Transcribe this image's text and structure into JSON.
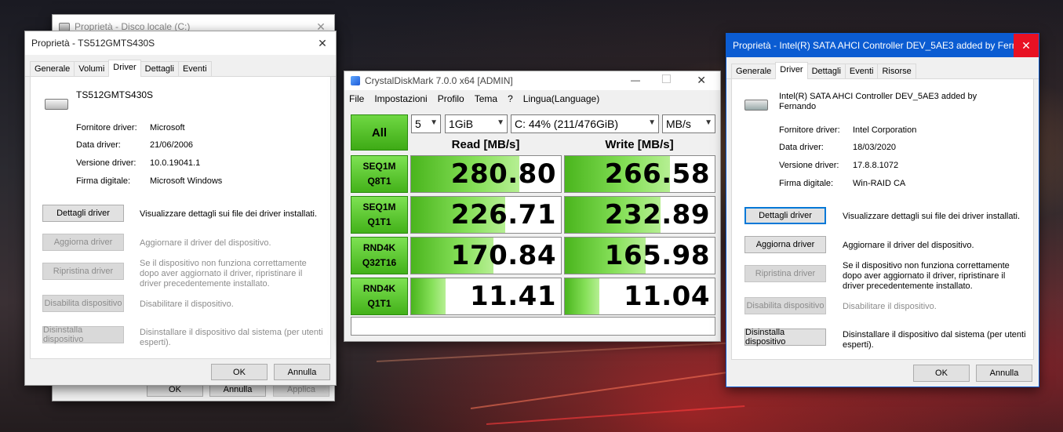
{
  "back_window": {
    "title": "Proprietà - Disco locale (C:)",
    "buttons": {
      "ok": "OK",
      "cancel": "Annulla",
      "apply": "Applica"
    }
  },
  "left_window": {
    "title": "Proprietà - TS512GMTS430S",
    "tabs": [
      "Generale",
      "Volumi",
      "Driver",
      "Dettagli",
      "Eventi"
    ],
    "active_tab": "Driver",
    "device_name": "TS512GMTS430S",
    "fields": [
      {
        "label": "Fornitore driver:",
        "value": "Microsoft"
      },
      {
        "label": "Data driver:",
        "value": "21/06/2006"
      },
      {
        "label": "Versione driver:",
        "value": "10.0.19041.1"
      },
      {
        "label": "Firma digitale:",
        "value": "Microsoft Windows"
      }
    ],
    "actions": [
      {
        "button": "Dettagli driver",
        "desc": "Visualizzare dettagli sui file dei driver installati.",
        "enabled": true
      },
      {
        "button": "Aggiorna driver",
        "desc": "Aggiornare il driver del dispositivo.",
        "enabled": false
      },
      {
        "button": "Ripristina driver",
        "desc": "Se il dispositivo non funziona correttamente dopo aver aggiornato il driver, ripristinare il driver precedentemente installato.",
        "enabled": false
      },
      {
        "button": "Disabilita dispositivo",
        "desc": "Disabilitare il dispositivo.",
        "enabled": false
      },
      {
        "button": "Disinstalla dispositivo",
        "desc": "Disinstallare il dispositivo dal sistema (per utenti esperti).",
        "enabled": false
      }
    ],
    "ok": "OK",
    "cancel": "Annulla"
  },
  "cdm": {
    "title": "CrystalDiskMark 7.0.0 x64 [ADMIN]",
    "menu": [
      "File",
      "Impostazioni",
      "Profilo",
      "Tema",
      "?",
      "Lingua(Language)"
    ],
    "all_button": "All",
    "count": "5",
    "size": "1GiB",
    "drive": "C: 44% (211/476GiB)",
    "unit": "MB/s",
    "read_header": "Read [MB/s]",
    "write_header": "Write [MB/s]",
    "rows": [
      {
        "line1": "SEQ1M",
        "line2": "Q8T1",
        "read": "280.80",
        "write": "266.58",
        "read_fill": 0.72,
        "write_fill": 0.7
      },
      {
        "line1": "SEQ1M",
        "line2": "Q1T1",
        "read": "226.71",
        "write": "232.89",
        "read_fill": 0.63,
        "write_fill": 0.64
      },
      {
        "line1": "RND4K",
        "line2": "Q32T16",
        "read": "170.84",
        "write": "165.98",
        "read_fill": 0.55,
        "write_fill": 0.54
      },
      {
        "line1": "RND4K",
        "line2": "Q1T1",
        "read": "11.41",
        "write": "11.04",
        "read_fill": 0.23,
        "write_fill": 0.23
      }
    ]
  },
  "right_window": {
    "title": "Proprietà - Intel(R) SATA AHCI Controller DEV_5AE3 added by Fern...",
    "tabs": [
      "Generale",
      "Driver",
      "Dettagli",
      "Eventi",
      "Risorse"
    ],
    "active_tab": "Driver",
    "device_name": "Intel(R) SATA AHCI Controller DEV_5AE3 added by Fernando",
    "fields": [
      {
        "label": "Fornitore driver:",
        "value": "Intel Corporation"
      },
      {
        "label": "Data driver:",
        "value": "18/03/2020"
      },
      {
        "label": "Versione driver:",
        "value": "17.8.8.1072"
      },
      {
        "label": "Firma digitale:",
        "value": "Win-RAID CA"
      }
    ],
    "actions": [
      {
        "button": "Dettagli driver",
        "desc": "Visualizzare dettagli sui file dei driver installati.",
        "enabled": true
      },
      {
        "button": "Aggiorna driver",
        "desc": "Aggiornare il driver del dispositivo.",
        "enabled": true
      },
      {
        "button": "Ripristina driver",
        "desc": "Se il dispositivo non funziona correttamente dopo aver aggiornato il driver, ripristinare il driver precedentemente installato.",
        "enabled": false
      },
      {
        "button": "Disabilita dispositivo",
        "desc": "Disabilitare il dispositivo.",
        "enabled": false
      },
      {
        "button": "Disinstalla dispositivo",
        "desc": "Disinstallare il dispositivo dal sistema (per utenti esperti).",
        "enabled": true
      }
    ],
    "ok": "OK",
    "cancel": "Annulla"
  }
}
